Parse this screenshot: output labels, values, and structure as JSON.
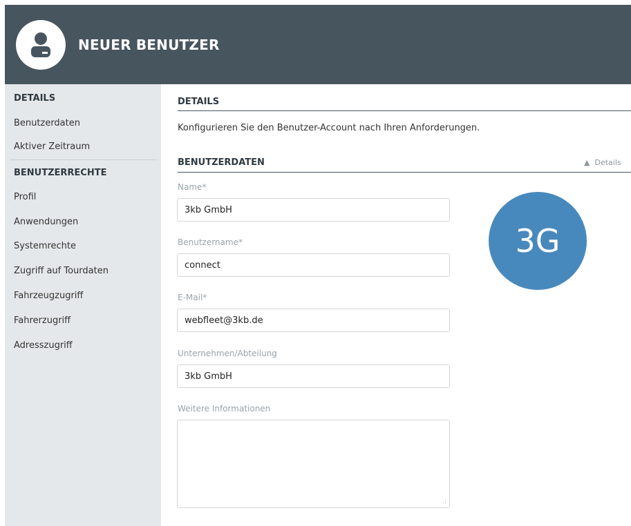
{
  "header": {
    "title": "NEUER BENUTZER",
    "avatar_icon": "user-icon"
  },
  "sidebar": {
    "sections": [
      {
        "heading": "DETAILS",
        "items": [
          "Benutzerdaten",
          "Aktiver Zeitraum"
        ]
      },
      {
        "heading": "BENUTZERRECHTE",
        "items": [
          "Profil",
          "Anwendungen",
          "Systemrechte",
          "Zugriff auf Tourdaten",
          "Fahrzeugzugriff",
          "Fahrerzugriff",
          "Adresszugriff"
        ]
      }
    ]
  },
  "main": {
    "details_title": "DETAILS",
    "details_description": "Konfigurieren Sie den Benutzer-Account nach Ihren Anforderungen.",
    "userdata_title": "BENUTZERDATEN",
    "collapse_label": "Details",
    "avatar_initials": "3G",
    "avatar_color": "#4889bd",
    "fields": [
      {
        "label": "Name*",
        "value": "3kb GmbH"
      },
      {
        "label": "Benutzername*",
        "value": "connect"
      },
      {
        "label": "E-Mail*",
        "value": "webfleet@3kb.de"
      },
      {
        "label": "Unternehmen/Abteilung",
        "value": "3kb GmbH"
      },
      {
        "label": "Weitere Informationen",
        "value": ""
      }
    ]
  },
  "colors": {
    "header_bg": "#47555f",
    "sidebar_bg": "#e5e8ea",
    "accent": "#4889bd"
  }
}
